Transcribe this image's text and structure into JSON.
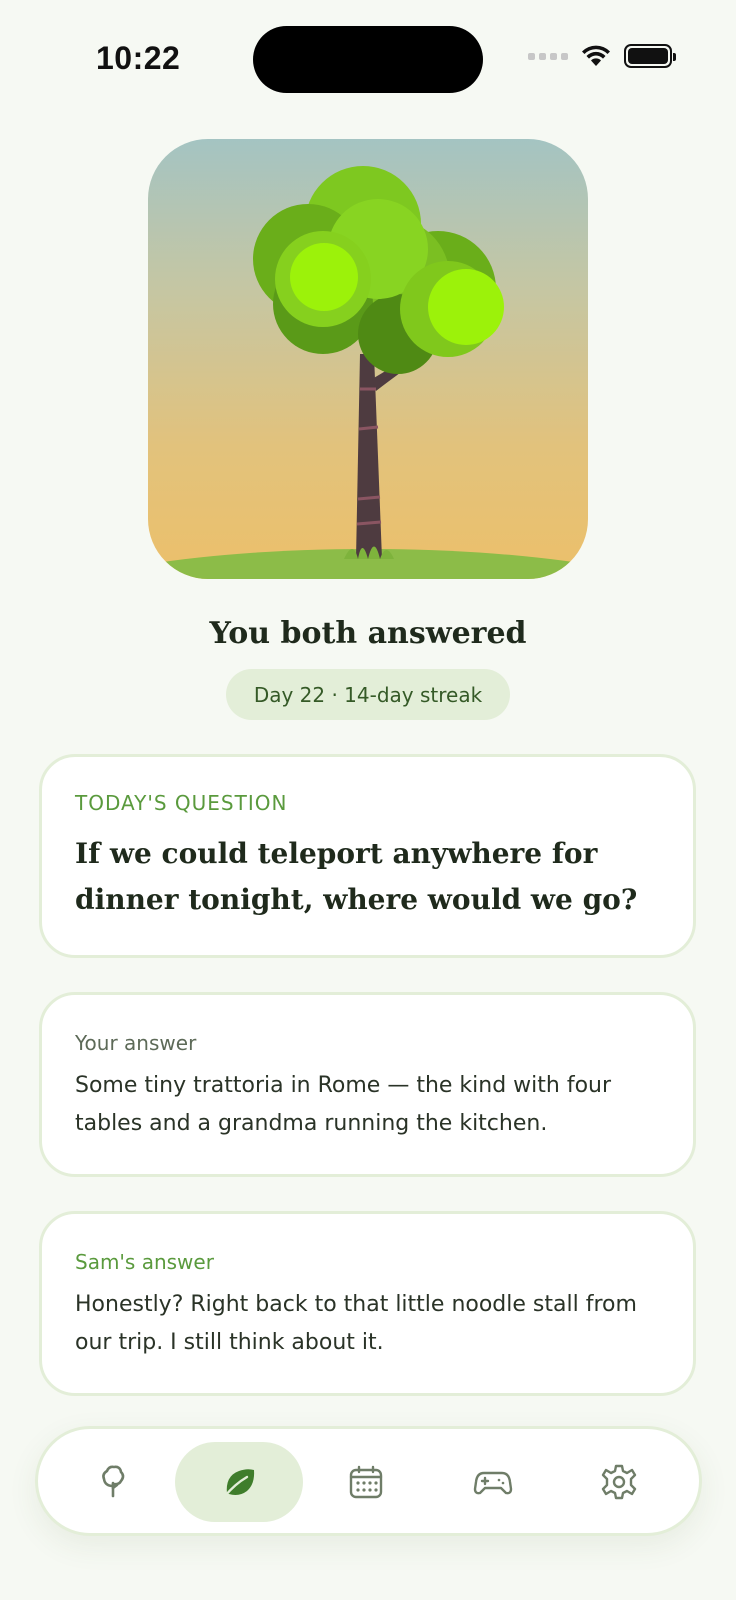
{
  "status_bar": {
    "time": "10:22"
  },
  "hero": {
    "headline": "You both answered",
    "streak": "Day 22 · 14-day streak"
  },
  "question": {
    "label": "TODAY'S QUESTION",
    "text": "If we could teleport anywhere for dinner tonight, where would we go?"
  },
  "answers": [
    {
      "label": "Your answer",
      "text": "Some tiny trattoria in Rome — the kind with four tables and a grandma running the kitchen."
    },
    {
      "label": "Sam's answer",
      "text": "Honestly? Right back to that little noodle stall from our trip. I still think about it."
    }
  ],
  "tabbar": {
    "items": [
      {
        "icon": "tree-icon",
        "active": false
      },
      {
        "icon": "leaf-icon",
        "active": true
      },
      {
        "icon": "calendar-icon",
        "active": false
      },
      {
        "icon": "gamepad-icon",
        "active": false
      },
      {
        "icon": "gear-icon",
        "active": false
      }
    ]
  },
  "colors": {
    "accent": "#5a9a3d",
    "accent_soft": "#e3eed8",
    "leaf_bright": "#9cf20a",
    "background": "#f6f9f3"
  }
}
